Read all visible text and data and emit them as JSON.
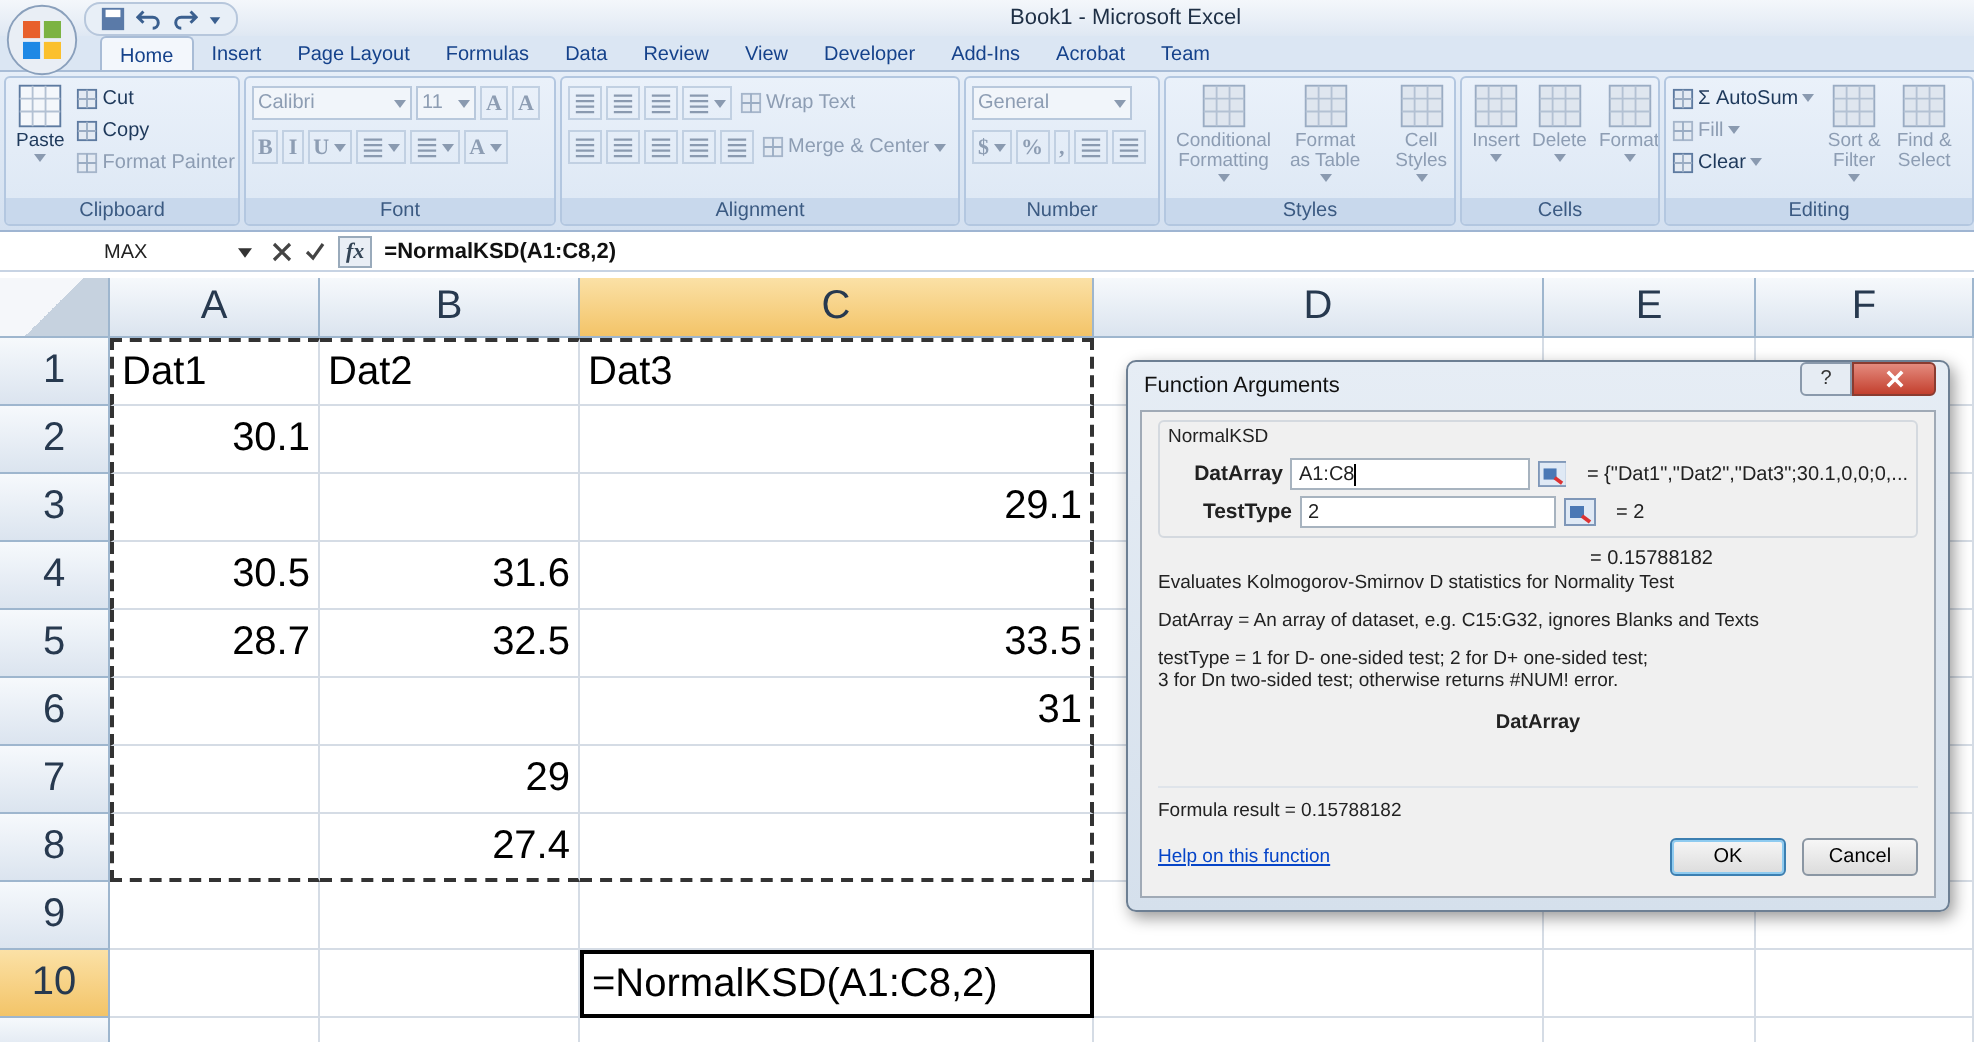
{
  "window": {
    "title": "Book1 - Microsoft Excel"
  },
  "ribbon_tabs": [
    {
      "label": "Home",
      "selected": true
    },
    {
      "label": "Insert",
      "selected": false
    },
    {
      "label": "Page Layout",
      "selected": false
    },
    {
      "label": "Formulas",
      "selected": false
    },
    {
      "label": "Data",
      "selected": false
    },
    {
      "label": "Review",
      "selected": false
    },
    {
      "label": "View",
      "selected": false
    },
    {
      "label": "Developer",
      "selected": false
    },
    {
      "label": "Add-Ins",
      "selected": false
    },
    {
      "label": "Acrobat",
      "selected": false
    },
    {
      "label": "Team",
      "selected": false
    }
  ],
  "ribbon_groups": [
    {
      "label": "Clipboard",
      "kind": "side_by_side",
      "lines": [
        [
          {
            "kind": "large",
            "label": "Paste",
            "dropdown": true,
            "disabled": false
          }
        ],
        [
          {
            "kind": "small",
            "label": "Cut",
            "dropdown": false,
            "disabled": false
          },
          {
            "kind": "small",
            "label": "Copy",
            "dropdown": false,
            "disabled": false
          },
          {
            "kind": "small",
            "label": "Format Painter",
            "dropdown": false,
            "disabled": true
          }
        ]
      ]
    },
    {
      "label": "Font",
      "kind": "stacked",
      "lines": [
        [
          {
            "kind": "wide_field",
            "label": "Calibri",
            "dropdown": true,
            "disabled": true
          },
          {
            "kind": "field",
            "label": "11",
            "dropdown": true,
            "disabled": true
          },
          {
            "kind": "letter",
            "label": "A",
            "dropdown": false,
            "disabled": true
          },
          {
            "kind": "letter",
            "label": "A",
            "dropdown": false,
            "disabled": true
          }
        ],
        [
          {
            "kind": "letter",
            "label": "B",
            "dropdown": false,
            "disabled": true
          },
          {
            "kind": "letter",
            "label": "I",
            "dropdown": false,
            "disabled": true
          },
          {
            "kind": "letter",
            "label": "U",
            "dropdown": true,
            "disabled": true
          },
          {
            "kind": "icon",
            "dropdown": true,
            "disabled": true
          },
          {
            "kind": "icon",
            "dropdown": true,
            "disabled": true
          },
          {
            "kind": "letter",
            "label": "A",
            "dropdown": true,
            "disabled": true
          }
        ]
      ]
    },
    {
      "label": "Alignment",
      "kind": "stacked",
      "lines": [
        [
          {
            "kind": "icon",
            "dropdown": false,
            "disabled": true
          },
          {
            "kind": "icon",
            "dropdown": false,
            "disabled": true
          },
          {
            "kind": "icon",
            "dropdown": false,
            "disabled": true
          },
          {
            "kind": "icon",
            "dropdown": true,
            "disabled": true
          },
          {
            "kind": "small",
            "label": "Wrap Text",
            "dropdown": false,
            "disabled": true
          }
        ],
        [
          {
            "kind": "icon",
            "dropdown": false,
            "disabled": true
          },
          {
            "kind": "icon",
            "dropdown": false,
            "disabled": true
          },
          {
            "kind": "icon",
            "dropdown": false,
            "disabled": true
          },
          {
            "kind": "icon",
            "dropdown": false,
            "disabled": true
          },
          {
            "kind": "icon",
            "dropdown": false,
            "disabled": true
          },
          {
            "kind": "small",
            "label": "Merge & Center",
            "dropdown": true,
            "disabled": true
          }
        ]
      ]
    },
    {
      "label": "Number",
      "kind": "stacked",
      "lines": [
        [
          {
            "kind": "wide_field",
            "label": "General",
            "dropdown": true,
            "disabled": true
          }
        ],
        [
          {
            "kind": "letter",
            "label": "$",
            "dropdown": true,
            "disabled": true
          },
          {
            "kind": "letter",
            "label": "%",
            "dropdown": false,
            "disabled": true
          },
          {
            "kind": "letter",
            "label": ",",
            "dropdown": false,
            "disabled": true
          },
          {
            "kind": "icon",
            "dropdown": false,
            "disabled": true
          },
          {
            "kind": "icon",
            "dropdown": false,
            "disabled": true
          }
        ]
      ]
    },
    {
      "label": "Styles",
      "kind": "side_by_side",
      "lines": [
        [
          {
            "kind": "large",
            "label": "Conditional Formatting",
            "dropdown": true,
            "disabled": true
          }
        ],
        [
          {
            "kind": "large",
            "label": "Format as Table",
            "dropdown": true,
            "disabled": true
          }
        ],
        [
          {
            "kind": "large",
            "label": "Cell Styles",
            "dropdown": true,
            "disabled": true
          }
        ]
      ]
    },
    {
      "label": "Cells",
      "kind": "side_by_side",
      "lines": [
        [
          {
            "kind": "large",
            "label": "Insert",
            "dropdown": true,
            "disabled": true
          }
        ],
        [
          {
            "kind": "large",
            "label": "Delete",
            "dropdown": true,
            "disabled": true
          }
        ],
        [
          {
            "kind": "large",
            "label": "Format",
            "dropdown": true,
            "disabled": true
          }
        ]
      ]
    },
    {
      "label": "Editing",
      "kind": "side_by_side",
      "lines": [
        [
          {
            "kind": "small",
            "label": "Σ AutoSum",
            "dropdown": true,
            "disabled": false
          },
          {
            "kind": "small",
            "label": "Fill",
            "dropdown": true,
            "disabled": true
          },
          {
            "kind": "small",
            "label": "Clear",
            "dropdown": true,
            "disabled": false
          }
        ],
        [
          {
            "kind": "large",
            "label": "Sort & Filter",
            "dropdown": true,
            "disabled": true
          }
        ],
        [
          {
            "kind": "large",
            "label": "Find & Select",
            "dropdown": false,
            "disabled": true
          }
        ]
      ]
    }
  ],
  "formula_bar": {
    "name_box": "MAX",
    "function_button": "fx",
    "formula": "=NormalKSD(A1:C8,2)"
  },
  "sheet": {
    "columns": [
      {
        "label": "A",
        "selected": false,
        "marquee": true
      },
      {
        "label": "B",
        "selected": false,
        "marquee": true
      },
      {
        "label": "C",
        "selected": true,
        "marquee": true
      },
      {
        "label": "D",
        "selected": false,
        "marquee": false
      },
      {
        "label": "E",
        "selected": false,
        "marquee": false
      },
      {
        "label": "F",
        "selected": false,
        "marquee": false
      }
    ],
    "rows": [
      {
        "label": "1",
        "selected": false,
        "marquee": true,
        "cells": [
          {
            "value": "Dat1",
            "kind": "text"
          },
          {
            "value": "Dat2",
            "kind": "text"
          },
          {
            "value": "Dat3",
            "kind": "text"
          },
          {},
          {},
          {}
        ]
      },
      {
        "label": "2",
        "selected": false,
        "marquee": true,
        "cells": [
          {
            "value": "30.1",
            "kind": "number"
          },
          {},
          {},
          {},
          {},
          {}
        ]
      },
      {
        "label": "3",
        "selected": false,
        "marquee": true,
        "cells": [
          {},
          {},
          {
            "value": "29.1",
            "kind": "number"
          },
          {},
          {},
          {}
        ]
      },
      {
        "label": "4",
        "selected": false,
        "marquee": true,
        "cells": [
          {
            "value": "30.5",
            "kind": "number"
          },
          {
            "value": "31.6",
            "kind": "number"
          },
          {},
          {},
          {},
          {}
        ]
      },
      {
        "label": "5",
        "selected": false,
        "marquee": true,
        "cells": [
          {
            "value": "28.7",
            "kind": "number"
          },
          {
            "value": "32.5",
            "kind": "number"
          },
          {
            "value": "33.5",
            "kind": "number"
          },
          {},
          {},
          {}
        ]
      },
      {
        "label": "6",
        "selected": false,
        "marquee": true,
        "cells": [
          {},
          {},
          {
            "value": "31",
            "kind": "number"
          },
          {},
          {},
          {}
        ]
      },
      {
        "label": "7",
        "selected": false,
        "marquee": true,
        "cells": [
          {},
          {
            "value": "29",
            "kind": "number"
          },
          {},
          {},
          {},
          {}
        ]
      },
      {
        "label": "8",
        "selected": false,
        "marquee": true,
        "cells": [
          {},
          {
            "value": "27.4",
            "kind": "number"
          },
          {},
          {},
          {},
          {}
        ]
      },
      {
        "label": "9",
        "selected": false,
        "marquee": false,
        "cells": [
          {},
          {},
          {},
          {},
          {},
          {}
        ]
      },
      {
        "label": "10",
        "selected": true,
        "marquee": false,
        "cells": [
          {},
          {},
          {
            "value": "=NormalKSD(A1:C8,2)",
            "kind": "text"
          },
          {},
          {},
          {}
        ]
      },
      {
        "selected": false,
        "marquee": false,
        "cells": [
          {},
          {},
          {},
          {},
          {},
          {}
        ]
      }
    ]
  },
  "dialog": {
    "title": "Function Arguments",
    "help_button": "?",
    "function_name": "NormalKSD",
    "arguments": [
      {
        "label": "DatArray",
        "value": "A1:C8",
        "focused": true,
        "result": "= {\"Dat1\",\"Dat2\",\"Dat3\";30.1,0,0;0,..."
      },
      {
        "label": "TestType",
        "value": "2",
        "focused": false,
        "result": "= 2"
      }
    ],
    "function_result": "= 0.15788182",
    "description": "Evaluates Kolmogorov-Smirnov D statistics for Normality Test",
    "argument_help": "DatArray = An array of dataset, e.g. C15:G32, ignores Blanks and Texts",
    "test_help": [
      "testType = 1 for D- one-sided test; 2 for D+ one-sided test;",
      "3 for Dn two-sided test; otherwise returns #NUM! error."
    ],
    "current_argument": "DatArray",
    "formula_result": "Formula result =  0.15788182",
    "help_link": "Help on this function",
    "buttons": [
      {
        "label": "OK",
        "default": true
      },
      {
        "label": "Cancel",
        "default": false
      }
    ]
  }
}
